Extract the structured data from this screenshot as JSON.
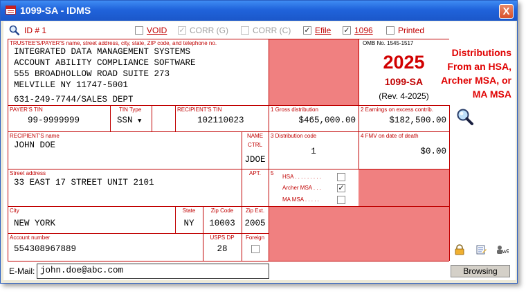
{
  "window": {
    "title": "1099-SA - IDMS",
    "close_label": "X"
  },
  "toolbar": {
    "id_label": "ID # 1",
    "void_label": "VOID",
    "void_checked": false,
    "corr_g_label": "CORR (G)",
    "corr_g_checked": true,
    "corr_c_label": "CORR (C)",
    "corr_c_checked": false,
    "efile_label": "Efile",
    "efile_checked": true,
    "f1096_label": "1096",
    "f1096_checked": true,
    "printed_label": "Printed",
    "printed_checked": false
  },
  "form": {
    "trustee_label": "TRUSTEE'S/PAYER'S name, street address, city, state, ZIP code, and telephone no.",
    "trustee_lines": [
      "INTEGRATED DATA MANAGEMENT SYSTEMS",
      "ACCOUNT ABILITY COMPLIANCE SOFTWARE",
      "555 BROADHOLLOW ROAD SUITE 273",
      "MELVILLE NY 11747-5001"
    ],
    "trustee_phone": "631-249-7744/SALES DEPT",
    "omb_label": "OMB No. 1545-1517",
    "year": "2025",
    "form_name": "1099-SA",
    "rev": "(Rev. 4-2025)",
    "side_title": [
      "Distributions",
      "From an HSA,",
      "Archer MSA, or",
      "MA MSA"
    ],
    "payer_tin_label": "PAYER'S TIN",
    "payer_tin": "99-9999999",
    "tin_type_label": "TIN Type",
    "tin_type": "SSN",
    "recipient_tin_label": "RECIPIENT'S TIN",
    "recipient_tin": "102110023",
    "box1_label": "1 Gross distribution",
    "box1_value": "$465,000.00",
    "box2_label": "2 Earnings on excess contrib.",
    "box2_value": "$182,500.00",
    "recipient_name_label": "RECIPIENT'S name",
    "recipient_name": "JOHN DOE",
    "name_ctrl_label_1": "NAME",
    "name_ctrl_label_2": "CTRL",
    "name_ctrl": "JDOE",
    "box3_label": "3 Distribution code",
    "box3_value": "1",
    "box4_label": "4 FMV on date of death",
    "box4_value": "$0.00",
    "street_label": "Street address",
    "street": "33 EAST 17 STREET UNIT 2101",
    "apt_label": "APT.",
    "box5_label": "5",
    "hsa_label": "HSA . . . . . . . . .",
    "hsa_checked": false,
    "archer_label": "Archer MSA . . .",
    "archer_checked": true,
    "mamsa_label": "MA MSA . . . . .",
    "mamsa_checked": false,
    "city_label": "City",
    "city": "NEW YORK",
    "state_label": "State",
    "state": "NY",
    "zip_label": "Zip Code",
    "zip": "10003",
    "zipext_label": "Zip Ext.",
    "zipext": "2005",
    "account_label": "Account number",
    "account": "554308967889",
    "uspsdp_label": "USPS DP",
    "uspsdp": "28",
    "foreign_label": "Foreign",
    "foreign_checked": false
  },
  "footer": {
    "email_label": "E-Mail:",
    "email_value": "john.doe@abc.com",
    "browse_label": "Browsing"
  },
  "colors": {
    "accent_red": "#c00000",
    "shade": "#f08080",
    "titlebar": "#2063db"
  }
}
